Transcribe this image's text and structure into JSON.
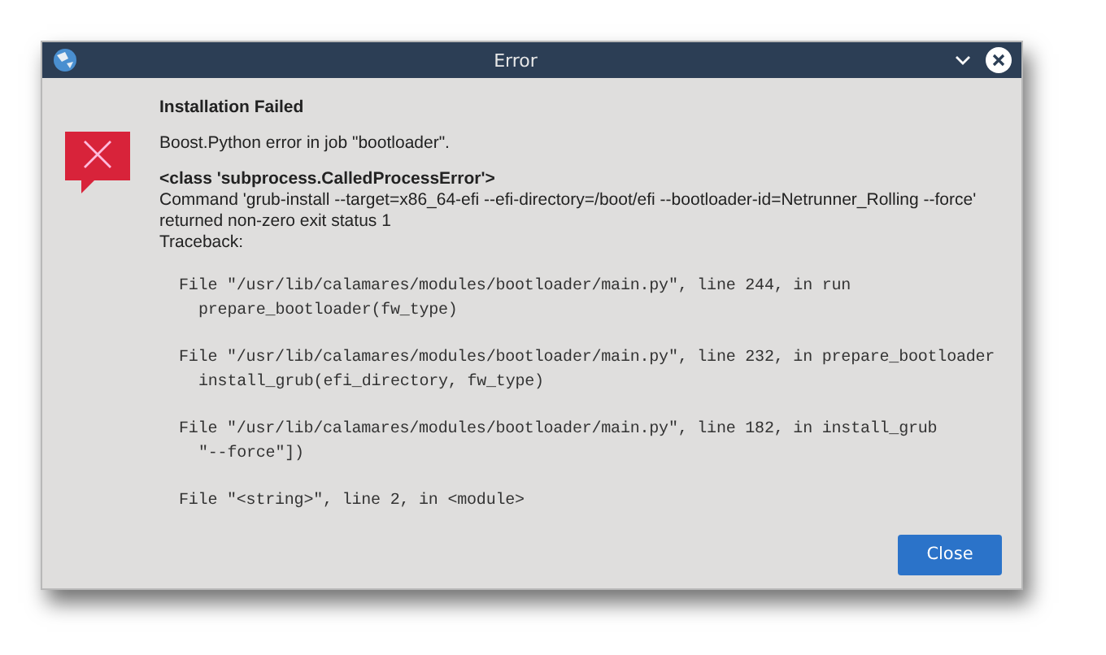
{
  "window": {
    "title": "Error"
  },
  "heading": "Installation Failed",
  "message": "Boost.Python error in job \"bootloader\".",
  "exception": "<class 'subprocess.CalledProcessError'>",
  "details": [
    "Command 'grub-install --target=x86_64-efi --efi-directory=/boot/efi --bootloader-id=Netrunner_Rolling --force'",
    "returned non-zero exit status 1",
    "Traceback:"
  ],
  "traceback": [
    {
      "file": "File \"/usr/lib/calamares/modules/bootloader/main.py\", line 244, in run",
      "code": "prepare_bootloader(fw_type)"
    },
    {
      "file": "File \"/usr/lib/calamares/modules/bootloader/main.py\", line 232, in prepare_bootloader",
      "code": "install_grub(efi_directory, fw_type)"
    },
    {
      "file": "File \"/usr/lib/calamares/modules/bootloader/main.py\", line 182, in install_grub",
      "code": "\"--force\"])"
    },
    {
      "file": "File \"<string>\", line 2, in <module>"
    }
  ],
  "buttons": [
    "Close"
  ]
}
